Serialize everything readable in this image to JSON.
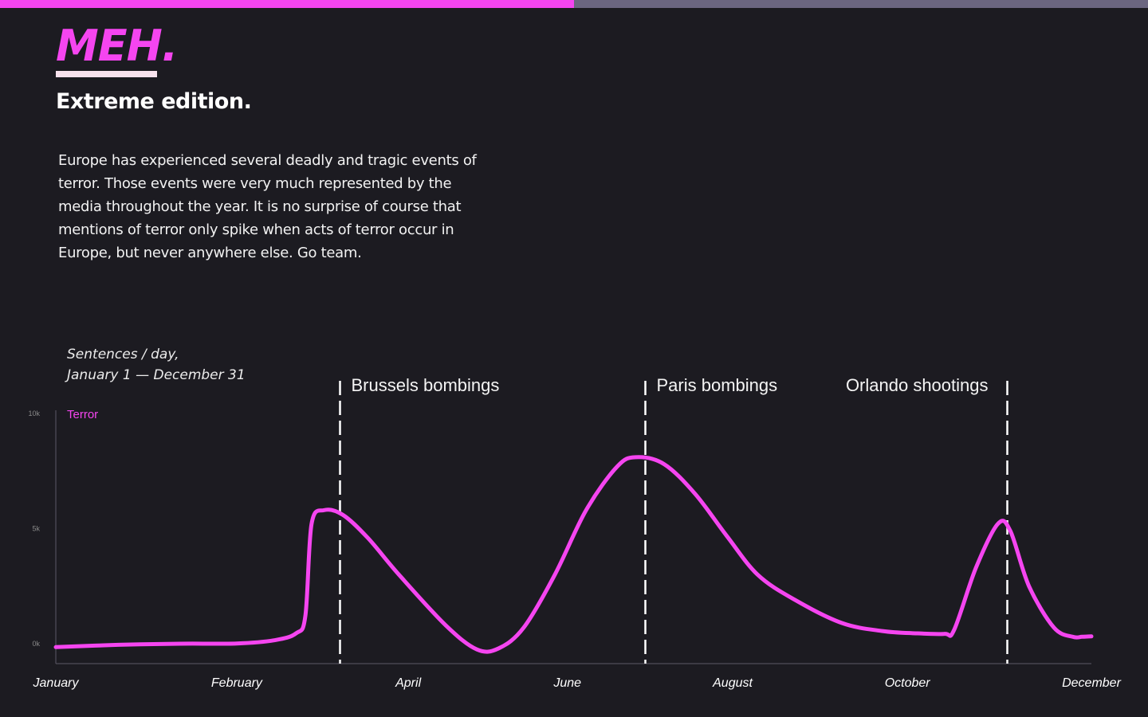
{
  "header": {
    "progress_fraction": 0.5,
    "progress_color": "#f545f0",
    "track_color": "#6b6680"
  },
  "brand": {
    "name": "MEH."
  },
  "page": {
    "subtitle": "Extreme edition.",
    "intro": "Europe has experienced several deadly and tragic events of terror. Those events were very much represented by the media throughout the year. It is no surprise of course that mentions of terror only spike when acts of terror occur in Europe, but never anywhere else. Go team."
  },
  "colors": {
    "background": "#1c1b21",
    "series": "#f545f0",
    "event_line": "#ffffff",
    "tick_text": "#8a8a8a"
  },
  "chart_data": {
    "type": "line",
    "caption_line1": "Sentences / day,",
    "caption_line2": "January 1 — December 31",
    "y_ticks": [
      {
        "value": 0,
        "label": "0k"
      },
      {
        "value": 5000,
        "label": "5k"
      },
      {
        "value": 10000,
        "label": "10k"
      }
    ],
    "ylim": [
      0,
      10000
    ],
    "x_ticks": [
      {
        "day": 0,
        "label": "January"
      },
      {
        "day": 58,
        "label": "February"
      },
      {
        "day": 113,
        "label": "April"
      },
      {
        "day": 164,
        "label": "June"
      },
      {
        "day": 217,
        "label": "August"
      },
      {
        "day": 273,
        "label": "October"
      },
      {
        "day": 332,
        "label": "December"
      }
    ],
    "xlim": [
      0,
      332
    ],
    "series": [
      {
        "name": "Terror",
        "points": [
          {
            "day": 0,
            "value": -150
          },
          {
            "day": 20,
            "value": -50
          },
          {
            "day": 40,
            "value": 0
          },
          {
            "day": 58,
            "value": 10
          },
          {
            "day": 70,
            "value": 150
          },
          {
            "day": 77,
            "value": 450
          },
          {
            "day": 80,
            "value": 1200
          },
          {
            "day": 82,
            "value": 5200
          },
          {
            "day": 86,
            "value": 5800
          },
          {
            "day": 92,
            "value": 5600
          },
          {
            "day": 100,
            "value": 4600
          },
          {
            "day": 110,
            "value": 3000
          },
          {
            "day": 125,
            "value": 800
          },
          {
            "day": 135,
            "value": -250
          },
          {
            "day": 142,
            "value": -200
          },
          {
            "day": 150,
            "value": 700
          },
          {
            "day": 160,
            "value": 3000
          },
          {
            "day": 170,
            "value": 5800
          },
          {
            "day": 180,
            "value": 7700
          },
          {
            "day": 186,
            "value": 8100
          },
          {
            "day": 195,
            "value": 7800
          },
          {
            "day": 205,
            "value": 6500
          },
          {
            "day": 215,
            "value": 4700
          },
          {
            "day": 225,
            "value": 3000
          },
          {
            "day": 237,
            "value": 1900
          },
          {
            "day": 252,
            "value": 900
          },
          {
            "day": 265,
            "value": 550
          },
          {
            "day": 276,
            "value": 450
          },
          {
            "day": 285,
            "value": 430
          },
          {
            "day": 288,
            "value": 600
          },
          {
            "day": 295,
            "value": 3300
          },
          {
            "day": 302,
            "value": 5200
          },
          {
            "day": 306,
            "value": 4900
          },
          {
            "day": 312,
            "value": 2500
          },
          {
            "day": 320,
            "value": 700
          },
          {
            "day": 326,
            "value": 300
          },
          {
            "day": 329,
            "value": 300
          },
          {
            "day": 332,
            "value": 320
          }
        ]
      }
    ],
    "events": [
      {
        "day": 91,
        "label": "Brussels bombings",
        "label_side": "right"
      },
      {
        "day": 189,
        "label": "Paris bombings",
        "label_side": "right"
      },
      {
        "day": 305,
        "label": "Orlando shootings",
        "label_side": "left"
      }
    ],
    "grid": false
  }
}
